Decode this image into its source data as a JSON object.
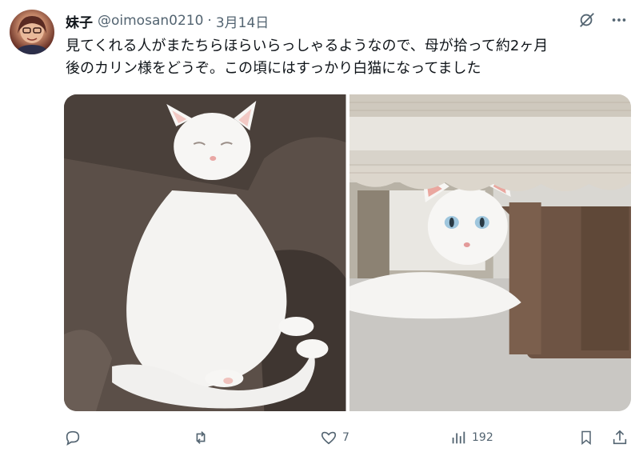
{
  "post": {
    "author_name": "妹子",
    "handle": "@oimosan0210",
    "separator": "·",
    "date": "3月14日",
    "text": "見てくれる人がまたちらほらいらっしゃるようなので、母が拾って約2ヶ月\n後のカリン様をどうぞ。この頃にはすっかり白猫になってました"
  },
  "media": [
    {
      "icon": "sleeping-white-cat-photo"
    },
    {
      "icon": "white-cat-under-curtain-photo"
    }
  ],
  "actions": {
    "reply_count": "",
    "repost_count": "",
    "like_count": "7",
    "view_count": "192"
  },
  "colors": {
    "text": "#0f1419",
    "muted": "#536471"
  }
}
